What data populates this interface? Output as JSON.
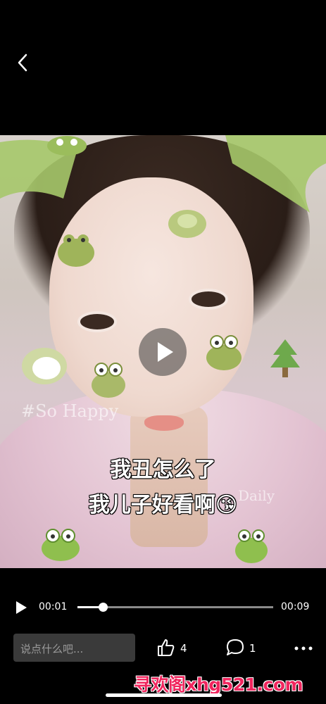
{
  "nav": {
    "back_icon": "chevron-left-icon"
  },
  "video": {
    "overlay_text_left": "#So  Happy",
    "overlay_text_right": "Daily",
    "caption_line1": "我丑怎么了",
    "caption_line2": "我儿子好看啊",
    "caption_emoji": "😘",
    "play_icon": "play-icon"
  },
  "player": {
    "current_time": "00:01",
    "total_time": "00:09",
    "progress": 0.13
  },
  "bottom_bar": {
    "comment_placeholder": "说点什么吧...",
    "like_count": "4",
    "comment_count": "1",
    "like_icon": "thumbs-up-icon",
    "comment_icon": "speech-bubble-icon",
    "more_icon": "more-dots-icon"
  },
  "watermark": {
    "text": "寻欢阁xhg521.com"
  },
  "colors": {
    "background": "#000000",
    "watermark": "#f0265e",
    "input_bg": "#3a3a3a"
  }
}
